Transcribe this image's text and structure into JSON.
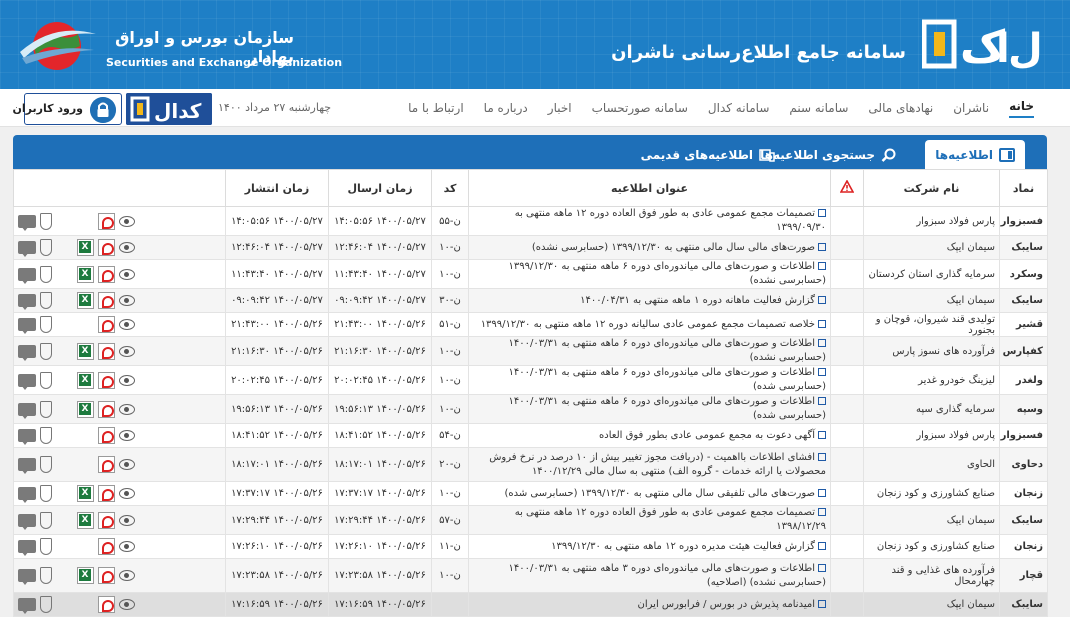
{
  "header": {
    "codal_title": "سامانه جامع اطلاع‌رسانی ناشران",
    "sec_title": "سازمان بورس و اوراق بهادار",
    "sec_subtitle": "Securities and Exchange Organization",
    "logo_icon": "codal-logo",
    "globe_icon": "globe-logo",
    "brand_color": "#1e7fc6"
  },
  "nav": {
    "items": [
      "خانه",
      "ناشران",
      "نهادهای مالی",
      "سامانه سنم",
      "سامانه کدال",
      "سامانه صورتحساب",
      "اخبار",
      "درباره ما",
      "ارتباط با ما"
    ],
    "date": "چهارشنبه ۲۷ مرداد ۱۴۰۰",
    "login_label": "ورود کاربران",
    "login_icon": "lock-icon"
  },
  "tabs": {
    "announcements": "اطلاعیه‌ها",
    "search": "جستجوی اطلاعیه‌ها",
    "old": "اطلاعیه‌های قدیمی"
  },
  "table": {
    "headers": {
      "symbol": "نماد",
      "company": "نام شرکت",
      "title": "عنوان اطلاعیه",
      "code": "کد",
      "sent": "زمان ارسال",
      "published": "زمان انتشار"
    },
    "rows": [
      {
        "symbol": "فسبزوار",
        "company": "پارس فولاد سبزوار",
        "title": "تصمیمات مجمع عمومی عادی به طور فوق العاده دوره ۱۲ ماهه منتهی به ۱۳۹۹/۰۹/۳۰",
        "code": "ن-۵۵",
        "sent": "۱۴۰۰/۰۵/۲۷ ۱۴:۰۵:۵۶",
        "published": "۱۴۰۰/۰۵/۲۷ ۱۴:۰۵:۵۶",
        "xls": false
      },
      {
        "symbol": "سایبک",
        "company": "سیمان ایپک",
        "title": "صورت‌های مالی سال مالی منتهی به ۱۳۹۹/۱۲/۳۰ (حسابرسی نشده)",
        "code": "ن-۱۰",
        "sent": "۱۴۰۰/۰۵/۲۷ ۱۲:۴۶:۰۴",
        "published": "۱۴۰۰/۰۵/۲۷ ۱۲:۴۶:۰۴",
        "xls": true
      },
      {
        "symbol": "وسکرد",
        "company": "سرمایه گذاری استان کردستان",
        "title": "اطلاعات و صورت‌های مالی میاندوره‌ای دوره ۶ ماهه منتهی به ۱۳۹۹/۱۲/۳۰ (حسابرسی نشده)",
        "code": "ن-۱۰",
        "sent": "۱۴۰۰/۰۵/۲۷ ۱۱:۴۳:۴۰",
        "published": "۱۴۰۰/۰۵/۲۷ ۱۱:۴۳:۴۰",
        "xls": true
      },
      {
        "symbol": "سایبک",
        "company": "سیمان ایپک",
        "title": "گزارش فعالیت ماهانه دوره ۱ ماهه منتهی به ۱۴۰۰/۰۴/۳۱",
        "code": "ن-۳۰",
        "sent": "۱۴۰۰/۰۵/۲۷ ۰۹:۰۹:۴۲",
        "published": "۱۴۰۰/۰۵/۲۷ ۰۹:۰۹:۴۲",
        "xls": true
      },
      {
        "symbol": "قشیر",
        "company": "تولیدی قند شیروان، قوچان و بجنورد",
        "title": "خلاصه تصمیمات مجمع عمومی عادی سالیانه دوره ۱۲ ماهه منتهی به ۱۳۹۹/۱۲/۳۰",
        "code": "ن-۵۱",
        "sent": "۱۴۰۰/۰۵/۲۶ ۲۱:۴۳:۰۰",
        "published": "۱۴۰۰/۰۵/۲۶ ۲۱:۴۳:۰۰",
        "xls": false
      },
      {
        "symbol": "کفپارس",
        "company": "فرآورده های نسوز پارس",
        "title": "اطلاعات و صورت‌های مالی میاندوره‌ای دوره ۶ ماهه منتهی به ۱۴۰۰/۰۳/۳۱ (حسابرسی نشده)",
        "code": "ن-۱۰",
        "sent": "۱۴۰۰/۰۵/۲۶ ۲۱:۱۶:۳۰",
        "published": "۱۴۰۰/۰۵/۲۶ ۲۱:۱۶:۳۰",
        "xls": true
      },
      {
        "symbol": "ولغدر",
        "company": "لیزینگ خودرو غدیر",
        "title": "اطلاعات و صورت‌های مالی میاندوره‌ای دوره ۶ ماهه منتهی به ۱۴۰۰/۰۳/۳۱ (حسابرسی شده)",
        "code": "ن-۱۰",
        "sent": "۱۴۰۰/۰۵/۲۶ ۲۰:۰۲:۴۵",
        "published": "۱۴۰۰/۰۵/۲۶ ۲۰:۰۲:۴۵",
        "xls": true
      },
      {
        "symbol": "وسپه",
        "company": "سرمایه گذاری سپه",
        "title": "اطلاعات و صورت‌های مالی میاندوره‌ای دوره ۶ ماهه منتهی به ۱۴۰۰/۰۳/۳۱ (حسابرسی شده)",
        "code": "ن-۱۰",
        "sent": "۱۴۰۰/۰۵/۲۶ ۱۹:۵۶:۱۳",
        "published": "۱۴۰۰/۰۵/۲۶ ۱۹:۵۶:۱۳",
        "xls": true
      },
      {
        "symbol": "فسبزوار",
        "company": "پارس فولاد سبزوار",
        "title": "آگهی دعوت به مجمع عمومی عادی بطور فوق العاده",
        "code": "ن-۵۴",
        "sent": "۱۴۰۰/۰۵/۲۶ ۱۸:۴۱:۵۲",
        "published": "۱۴۰۰/۰۵/۲۶ ۱۸:۴۱:۵۲",
        "xls": false
      },
      {
        "symbol": "دحاوی",
        "company": "الحاوی",
        "title": "افشای اطلاعات بااهمیت - (دریافت مجوز تغییر بیش از ۱۰ درصد در نرخ فروش محصولات یا ارائه خدمات - گروه الف) منتهی به سال مالی ۱۴۰۰/۱۲/۲۹",
        "code": "ن-۲۰",
        "sent": "۱۴۰۰/۰۵/۲۶ ۱۸:۱۷:۰۱",
        "published": "۱۴۰۰/۰۵/۲۶ ۱۸:۱۷:۰۱",
        "xls": false,
        "tall": true
      },
      {
        "symbol": "زنجان",
        "company": "صنایع کشاورزی و کود زنجان",
        "title": "صورت‌های مالی تلفیقی سال مالی منتهی به ۱۳۹۹/۱۲/۳۰ (حسابرسی شده)",
        "code": "ن-۱۰",
        "sent": "۱۴۰۰/۰۵/۲۶ ۱۷:۳۷:۱۷",
        "published": "۱۴۰۰/۰۵/۲۶ ۱۷:۳۷:۱۷",
        "xls": true
      },
      {
        "symbol": "سایبک",
        "company": "سیمان ایپک",
        "title": "تصمیمات مجمع عمومی عادی به طور فوق العاده دوره ۱۲ ماهه منتهی به ۱۳۹۸/۱۲/۲۹",
        "code": "ن-۵۷",
        "sent": "۱۴۰۰/۰۵/۲۶ ۱۷:۲۹:۴۴",
        "published": "۱۴۰۰/۰۵/۲۶ ۱۷:۲۹:۴۴",
        "xls": true
      },
      {
        "symbol": "زنجان",
        "company": "صنایع کشاورزی و کود زنجان",
        "title": "گزارش فعالیت هیئت مدیره دوره ۱۲ ماهه منتهی به ۱۳۹۹/۱۲/۳۰",
        "code": "ن-۱۱",
        "sent": "۱۴۰۰/۰۵/۲۶ ۱۷:۲۶:۱۰",
        "published": "۱۴۰۰/۰۵/۲۶ ۱۷:۲۶:۱۰",
        "xls": false
      },
      {
        "symbol": "قچار",
        "company": "فرآورده های غذایی و قند چهارمحال",
        "title": "اطلاعات و صورت‌های مالی میاندوره‌ای دوره ۳ ماهه منتهی به ۱۴۰۰/۰۳/۳۱ (حسابرسی نشده) (اصلاحیه)",
        "code": "ن-۱۰",
        "sent": "۱۴۰۰/۰۵/۲۶ ۱۷:۲۳:۵۸",
        "published": "۱۴۰۰/۰۵/۲۶ ۱۷:۲۳:۵۸",
        "xls": true,
        "tall": true
      },
      {
        "symbol": "سایبک",
        "company": "سیمان ایپک",
        "title": "امیدنامه پذیرش در بورس / فرابورس ایران",
        "code": "",
        "sent": "۱۴۰۰/۰۵/۲۶ ۱۷:۱۶:۵۹",
        "published": "۱۴۰۰/۰۵/۲۶ ۱۷:۱۶:۵۹",
        "xls": false
      }
    ]
  }
}
